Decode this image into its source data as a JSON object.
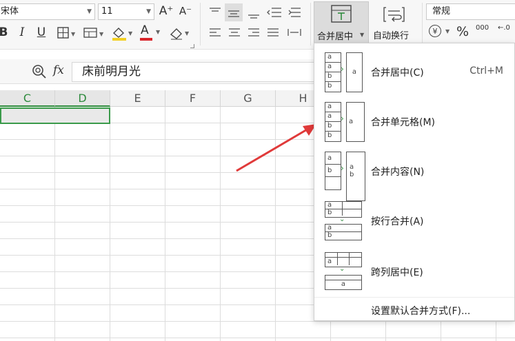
{
  "ribbon": {
    "font_name": "宋体",
    "font_size": "11",
    "increase_font": "A⁺",
    "decrease_font": "A⁻",
    "bold": "B",
    "italic": "I",
    "underline": "U",
    "font_color_letter": "A",
    "merge_center_label": "合并居中",
    "wrap_text_label": "自动换行",
    "number_format": "常规",
    "percent": "%",
    "thousands": "000",
    "currency": "¥"
  },
  "formula_bar": {
    "fx": "fx",
    "content": "床前明月光"
  },
  "columns": [
    "C",
    "D",
    "E",
    "F",
    "G",
    "H"
  ],
  "merge_menu": {
    "items": [
      {
        "label": "合并居中(C)",
        "shortcut": "Ctrl+M"
      },
      {
        "label": "合并单元格(M)",
        "shortcut": ""
      },
      {
        "label": "合并内容(N)",
        "shortcut": ""
      },
      {
        "label": "按行合并(A)",
        "shortcut": ""
      },
      {
        "label": "跨列居中(E)",
        "shortcut": ""
      },
      {
        "label": "设置默认合并方式(F)...",
        "shortcut": ""
      }
    ]
  },
  "icon_letters": {
    "a": "a",
    "b": "b"
  },
  "colors": {
    "accent_green": "#2e8b3d",
    "arrow_red": "#e03a3a",
    "font_color_red": "#d9262b",
    "highlight_yellow": "#f2d024"
  }
}
